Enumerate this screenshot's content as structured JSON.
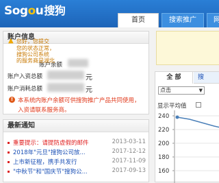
{
  "header": {
    "logo_main": "Sog",
    "logo_o": "o",
    "logo_u": "u",
    "logo_cn": "搜狗",
    "tabs": [
      "首页",
      "搜索推广",
      "网"
    ]
  },
  "account": {
    "title": "账户信息",
    "rows": [
      {
        "label": "账户余额",
        "suffix": "元"
      },
      {
        "label": "账户入资总额",
        "suffix": "元"
      },
      {
        "label": "账户消耗总额",
        "suffix": "元"
      }
    ],
    "notice_icon": "!",
    "notice_lines": [
      "本系统内账户余额可供搜狗推广产品共同使用，",
      "入资请联系服务商。"
    ]
  },
  "news": {
    "title": "最新通知",
    "items": [
      {
        "title": "重要提示：请提防虚假的邮件",
        "date": "2013-03-11",
        "hot": true
      },
      {
        "title": "2018年\"元旦\"搜狗公司放...",
        "date": "2017-12-12",
        "hot": false
      },
      {
        "title": "上市新征程，携手共发行",
        "date": "2017-11-09",
        "hot": false
      },
      {
        "title": "\"中秋节\"和\"国庆节\"搜狗公...",
        "date": "2017-09-13",
        "hot": false
      }
    ]
  },
  "alert": {
    "icon": "warning-icon",
    "lines": [
      "您好，您提交",
      "您的状态正常，",
      "搜狗公司系统",
      "的服务商是湖北"
    ]
  },
  "chart_panel": {
    "tab_all": "全 部",
    "tab_other": "搜",
    "metric": "点击",
    "avg_label": "显示平均值"
  },
  "chart_data": {
    "type": "line",
    "title": "",
    "xlabel": "",
    "ylabel": "",
    "y_ticks": [
      240,
      220,
      200,
      180,
      160
    ],
    "ylim": [
      160,
      240
    ],
    "series": [
      {
        "values": [
          238,
          235,
          230,
          225,
          221
        ]
      }
    ],
    "grid": true
  },
  "colors": {
    "header_blue": "#1d64b8",
    "link_blue": "#1a4fb5",
    "alert_red": "#e0381a",
    "alert_bg": "#fdf8d8",
    "series_line": "#4a7fb8"
  }
}
